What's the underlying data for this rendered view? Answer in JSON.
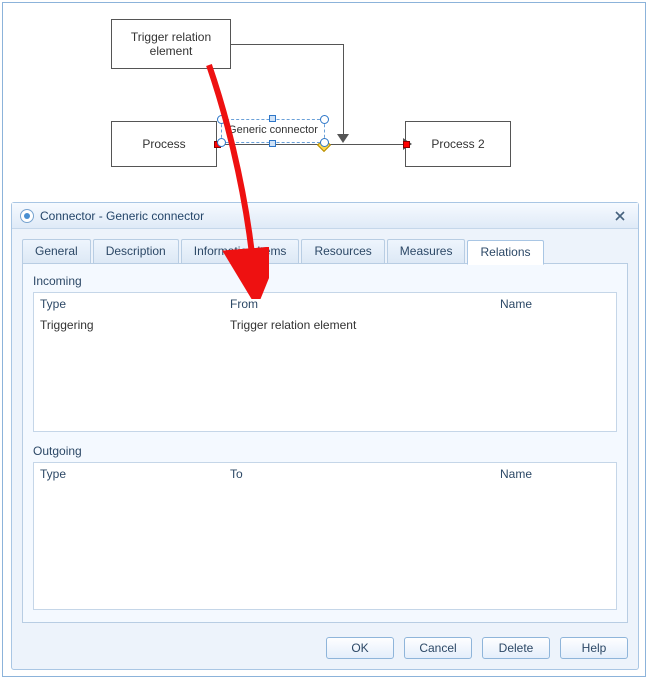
{
  "diagram": {
    "trigger_box": "Trigger relation element",
    "process_box": "Process",
    "process2_box": "Process 2",
    "connector_label": "Generic connector"
  },
  "dialog": {
    "title": "Connector - Generic connector",
    "tabs": {
      "general": "General",
      "description": "Description",
      "info_items": "Information Items",
      "resources": "Resources",
      "measures": "Measures",
      "relations": "Relations"
    },
    "sections": {
      "incoming_title": "Incoming",
      "outgoing_title": "Outgoing"
    },
    "columns": {
      "type": "Type",
      "from": "From",
      "to": "To",
      "name": "Name"
    },
    "incoming_rows": [
      {
        "type": "Triggering",
        "from": "Trigger relation element",
        "name": ""
      }
    ],
    "buttons": {
      "ok": "OK",
      "cancel": "Cancel",
      "delete": "Delete",
      "help": "Help"
    }
  }
}
